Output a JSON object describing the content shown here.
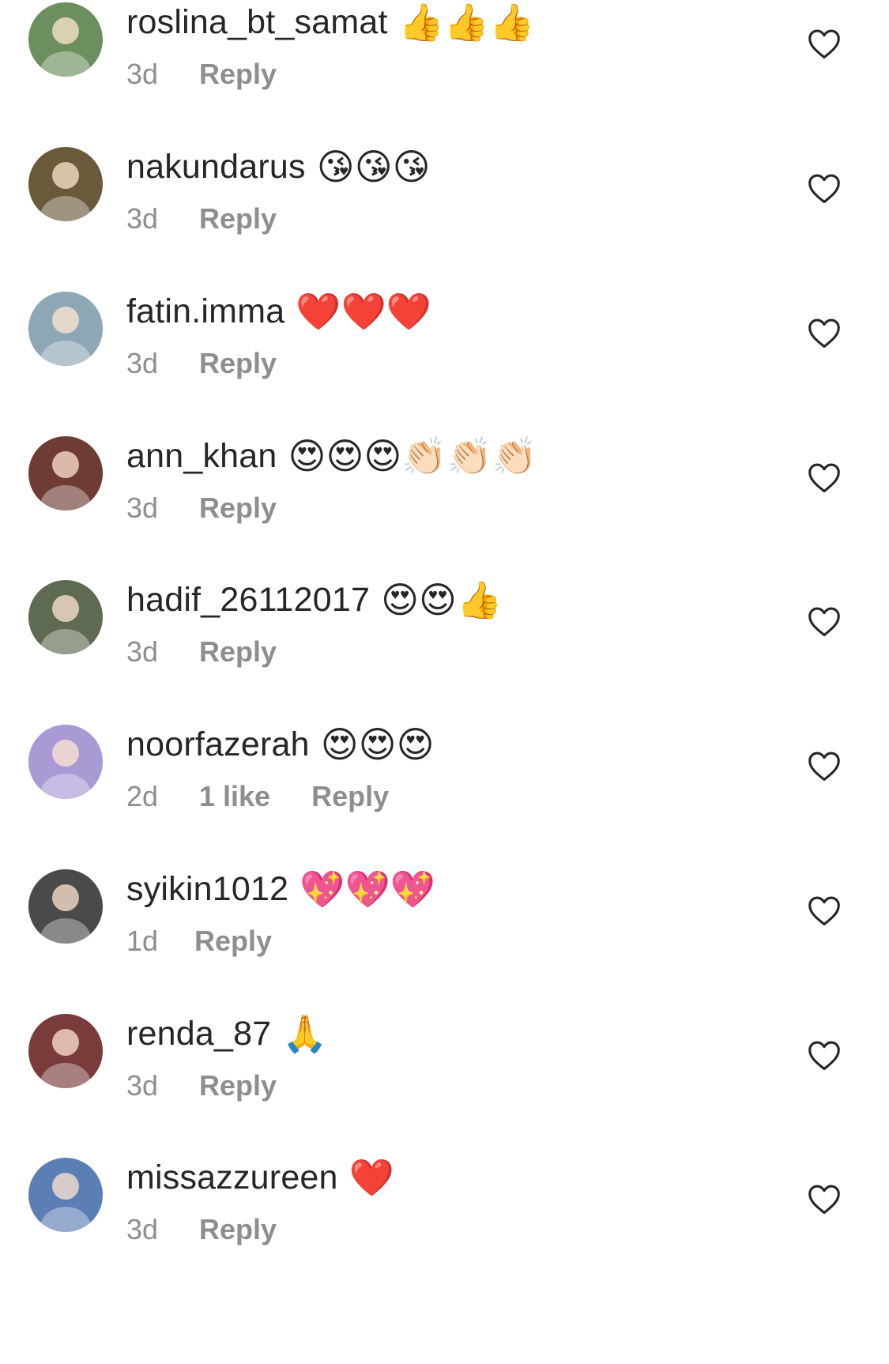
{
  "comments": [
    {
      "username": "roslina_bt_samat",
      "emoji": "👍👍👍",
      "time": "3d",
      "likes": "",
      "reply": "Reply",
      "avatar_color": "#6b8f5e"
    },
    {
      "username": "nakundarus",
      "emoji": "😘😘😘",
      "time": "3d",
      "likes": "",
      "reply": "Reply",
      "avatar_color": "#6a5a3c"
    },
    {
      "username": "fatin.imma",
      "emoji": "❤️❤️❤️",
      "time": "3d",
      "likes": "",
      "reply": "Reply",
      "avatar_color": "#8ea7b5"
    },
    {
      "username": "ann_khan",
      "emoji": "😍😍😍👏🏻👏🏻👏🏻",
      "time": "3d",
      "likes": "",
      "reply": "Reply",
      "avatar_color": "#6e3c34"
    },
    {
      "username": "hadif_26112017",
      "emoji": "😍😍👍",
      "time": "3d",
      "likes": "",
      "reply": "Reply",
      "avatar_color": "#5f6a52"
    },
    {
      "username": "noorfazerah",
      "emoji": "😍😍😍",
      "time": "2d",
      "likes": "1 like",
      "reply": "Reply",
      "avatar_color": "#a99ad6"
    },
    {
      "username": "syikin1012",
      "emoji": "💖💖💖",
      "time": "1d",
      "likes": "",
      "reply": "Reply",
      "avatar_color": "#4a4a4a"
    },
    {
      "username": "renda_87",
      "emoji": "🙏",
      "time": "3d",
      "likes": "",
      "reply": "Reply",
      "avatar_color": "#7a3b3b"
    },
    {
      "username": "missazzureen",
      "emoji": "❤️",
      "time": "3d",
      "likes": "",
      "reply": "Reply",
      "avatar_color": "#5b7fb5"
    }
  ],
  "icons": {
    "like": "heart-outline-icon",
    "avatar": "profile-photo"
  },
  "colors": {
    "username": "#262626",
    "meta": "#8e8e8e",
    "background": "#ffffff"
  }
}
